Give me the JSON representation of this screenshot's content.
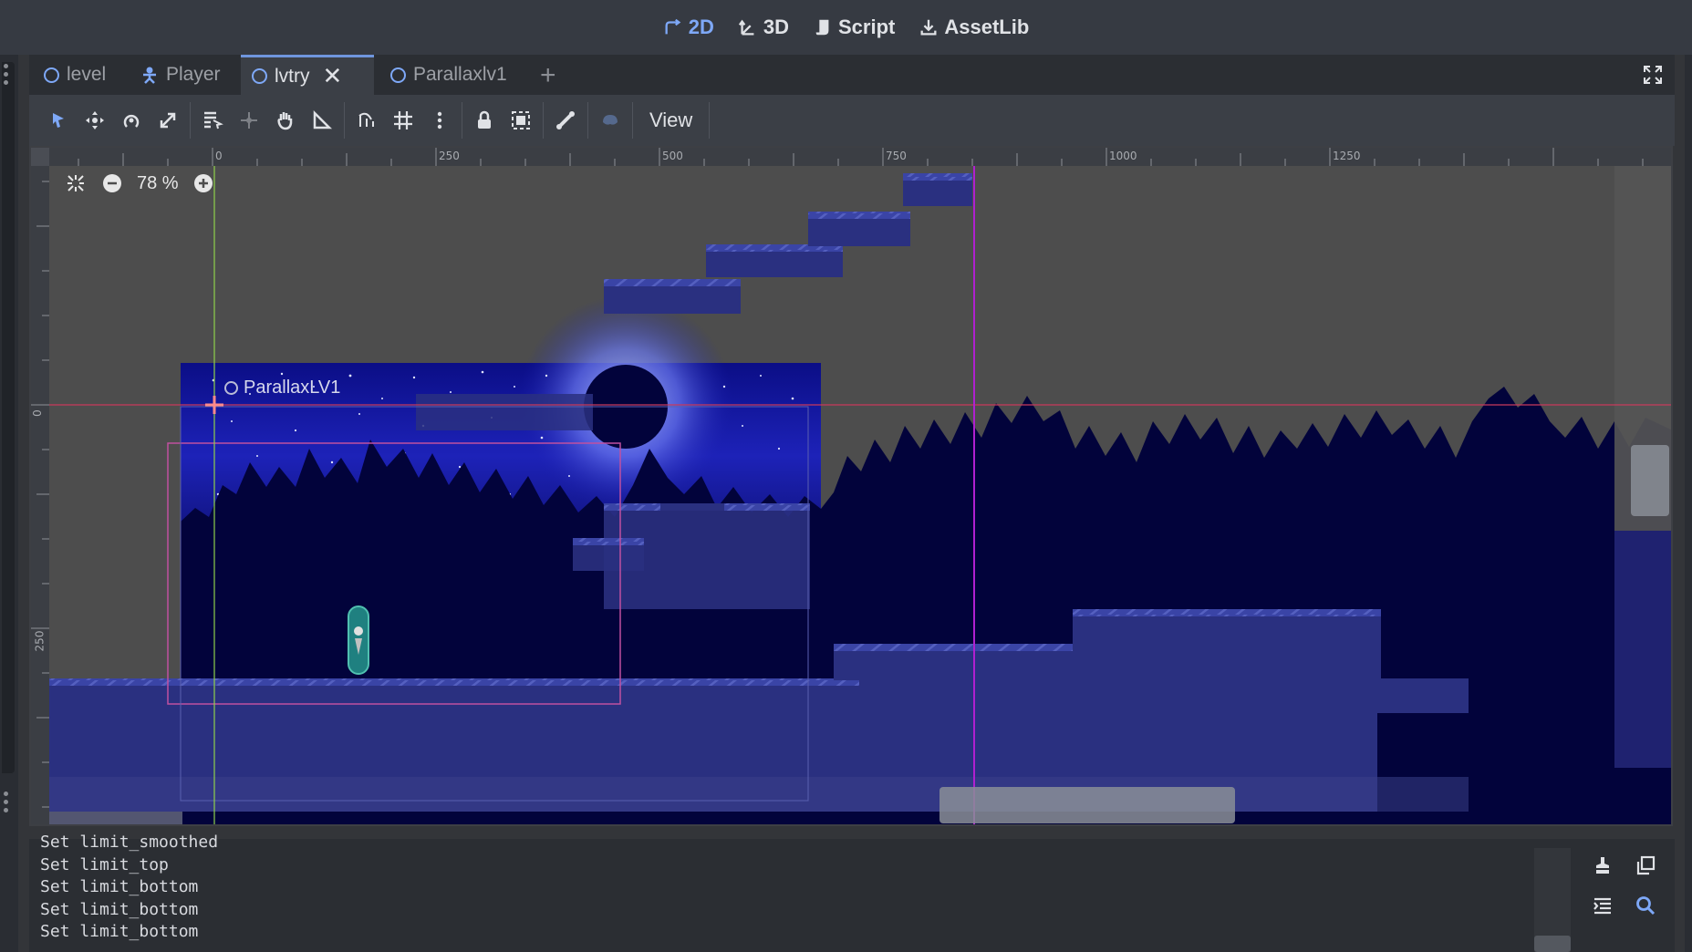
{
  "workspaces": [
    {
      "label": "2D",
      "icon": "2d-icon",
      "active": true
    },
    {
      "label": "3D",
      "icon": "3d-icon",
      "active": false
    },
    {
      "label": "Script",
      "icon": "script-icon",
      "active": false
    },
    {
      "label": "AssetLib",
      "icon": "assetlib-icon",
      "active": false
    }
  ],
  "tabs": [
    {
      "label": "level",
      "icon": "node2d-circle-icon"
    },
    {
      "label": "Player",
      "icon": "character-icon"
    },
    {
      "label": "lvtry",
      "icon": "node2d-circle-icon",
      "active": true
    },
    {
      "label": "Parallaxlv1",
      "icon": "node2d-circle-icon"
    }
  ],
  "toolbar": {
    "tools": [
      "select-tool-icon",
      "move-tool-icon",
      "rotate-tool-icon",
      "scale-tool-icon",
      "list-select-icon",
      "pivot-tool-icon",
      "pan-tool-icon",
      "ruler-tool-icon",
      "smart-snap-icon",
      "grid-snap-icon",
      "snap-options-icon",
      "lock-icon",
      "group-icon",
      "skeleton-icon",
      "bone-icon"
    ],
    "view_label": "View"
  },
  "viewport": {
    "zoom_label": "78 %",
    "ruler_h_labels": [
      "0",
      "250",
      "500",
      "750",
      "1000",
      "1250"
    ],
    "ruler_v_labels": [
      "0",
      "250"
    ],
    "node_label": "ParallaxLV1",
    "colors": {
      "background": "#4d4d4d",
      "sky": "#1a1fb0",
      "night": "#02033b",
      "tile": "#2a3080",
      "guide_vertical": "#b020d0",
      "guide_horizontal": "#c83a5c",
      "axis_y": "#8fd04a"
    }
  },
  "output": {
    "lines": [
      "Set limit_smoothed",
      "Set limit_top",
      "Set limit_bottom",
      "Set limit_bottom",
      "Set limit_bottom"
    ]
  }
}
